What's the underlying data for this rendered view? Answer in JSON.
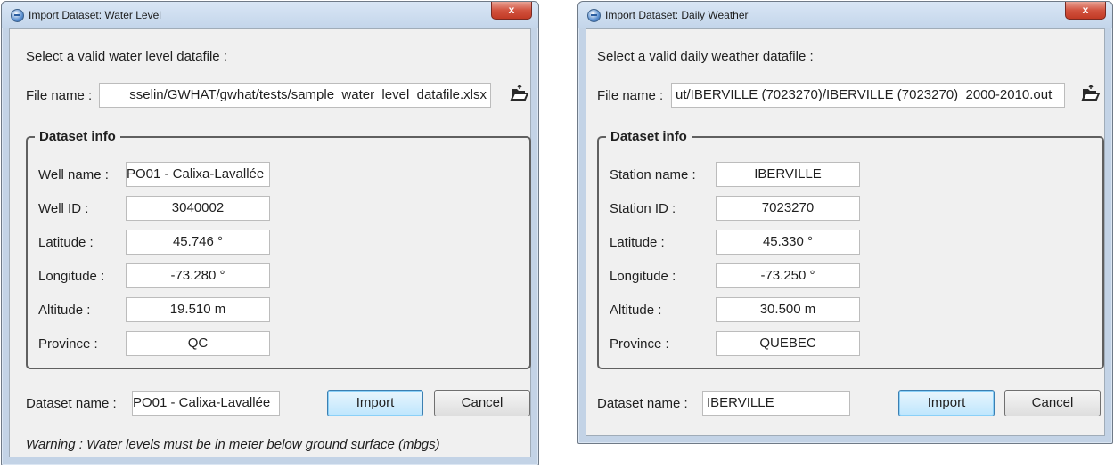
{
  "water_dialog": {
    "title": "Import Dataset: Water Level",
    "close_label": "x",
    "prompt": "Select a valid water level datafile :",
    "file_label": "File name :",
    "file_value": "sselin/GWHAT/gwhat/tests/sample_water_level_datafile.xlsx",
    "group_title": "Dataset info",
    "rows": [
      {
        "label": "Well name :",
        "value": "PO01 - Calixa-Lavallée"
      },
      {
        "label": "Well ID :",
        "value": "3040002"
      },
      {
        "label": "Latitude :",
        "value": "45.746 °"
      },
      {
        "label": "Longitude :",
        "value": "-73.280 °"
      },
      {
        "label": "Altitude :",
        "value": "19.510 m"
      },
      {
        "label": "Province :",
        "value": "QC"
      }
    ],
    "dataset_label": "Dataset name :",
    "dataset_value": "PO01 - Calixa-Lavallée",
    "import_label": "Import",
    "cancel_label": "Cancel",
    "warning": "Warning : Water levels must be in meter below ground surface (mbgs)"
  },
  "weather_dialog": {
    "title": "Import Dataset: Daily Weather",
    "close_label": "x",
    "prompt": "Select a valid daily weather datafile :",
    "file_label": "File name :",
    "file_value": "ut/IBERVILLE (7023270)/IBERVILLE (7023270)_2000-2010.out",
    "group_title": "Dataset info",
    "rows": [
      {
        "label": "Station name :",
        "value": "IBERVILLE"
      },
      {
        "label": "Station ID :",
        "value": "7023270"
      },
      {
        "label": "Latitude :",
        "value": "45.330 °"
      },
      {
        "label": "Longitude :",
        "value": "-73.250 °"
      },
      {
        "label": "Altitude :",
        "value": "30.500 m"
      },
      {
        "label": "Province :",
        "value": "QUEBEC"
      }
    ],
    "dataset_label": "Dataset name :",
    "dataset_value": "IBERVILLE",
    "import_label": "Import",
    "cancel_label": "Cancel"
  },
  "icons": {
    "app": "app-icon",
    "open_file": "open-file-icon"
  }
}
